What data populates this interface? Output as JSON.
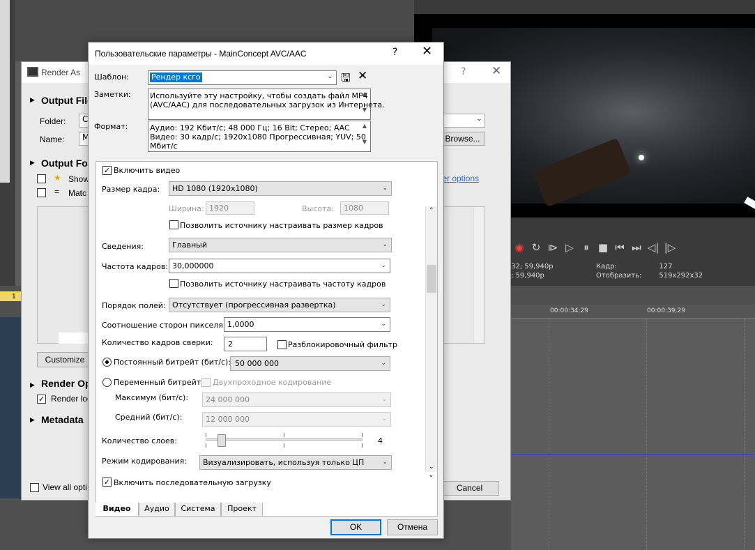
{
  "background": {
    "transport_icons": [
      "record-icon",
      "loop-icon",
      "play-from-start-icon",
      "play-icon",
      "pause-icon",
      "stop-icon",
      "prev-frame-icon",
      "next-frame-icon",
      "prev-marker-icon",
      "next-marker-icon"
    ],
    "info_left": [
      "32; 59,940p",
      "; 59,940p"
    ],
    "info_right_labels": [
      "Кадр:",
      "Отобразить:"
    ],
    "info_right_values": [
      "127",
      "519x292x32"
    ],
    "ruler_times": [
      "00:00:34;29",
      "00:00:39;29"
    ],
    "left_ruler_num": "1"
  },
  "render_as": {
    "title": "Render As",
    "sections": {
      "output_file": "Output File",
      "output_format": "Output Fo",
      "render_options": "Render Op",
      "metadata": "Metadata"
    },
    "folder_label": "Folder:",
    "folder_value": "C",
    "name_label": "Name:",
    "name_value": "M",
    "browse_label": "Browse...",
    "show_label": "Show",
    "match_label": "Matc",
    "customize_label": "Customize",
    "render_loop_label": "Render loc",
    "view_all_label": "View all opti",
    "cancel_label": "Cancel",
    "filter_link": "ter options"
  },
  "dialog": {
    "title": "Пользовательские параметры - MainConcept AVC/AAC",
    "help": "?",
    "template_label": "Шаблон:",
    "template_value": "Рендер ксго",
    "notes_label": "Заметки:",
    "notes_text": [
      "Используйте эту настройку, чтобы создать файл MP4",
      "(AVC/AAC) для последовательных загрузок из Интернета."
    ],
    "format_label": "Формат:",
    "format_text": [
      "Аудио: 192 Кбит/с; 48 000 Гц; 16 Bit; Стерео; AAC",
      "Видео: 30 кадр/с; 1920x1080 Прогрессивная; YUV; 50",
      "Мбит/с"
    ],
    "enable_video_label": "Включить видео",
    "frame_size_label": "Размер кадра:",
    "frame_size_value": "HD 1080 (1920x1080)",
    "width_label": "Ширина:",
    "width_value": "1920",
    "height_label": "Высота:",
    "height_value": "1080",
    "allow_frame_size_label": "Позволить источнику настраивать размер кадров",
    "profile_label": "Сведения:",
    "profile_value": "Главный",
    "frame_rate_label": "Частота кадров:",
    "frame_rate_value": "30,000000",
    "allow_frame_rate_label": "Позволить источнику настраивать частоту кадров",
    "field_order_label": "Порядок полей:",
    "field_order_value": "Отсутствует (прогрессивная развертка)",
    "pixel_aspect_label": "Соотношение сторон пикселя:",
    "pixel_aspect_value": "1,0000",
    "ref_frames_label": "Количество кадров сверки:",
    "ref_frames_value": "2",
    "deblock_label": "Разблокировочный фильтр",
    "cbr_label": "Постоянный битрейт (бит/с):",
    "cbr_value": "50 000 000",
    "vbr_label": "Переменный битрейт",
    "two_pass_label": "Двухпроходное кодирование",
    "max_label": "Максимум (бит/с):",
    "max_value": "24 000 000",
    "avg_label": "Средний (бит/с):",
    "avg_value": "12 000 000",
    "slices_label": "Количество слоев:",
    "slices_value": "4",
    "slices_level": 0.1,
    "encode_mode_label": "Режим кодирования:",
    "encode_mode_value": "Визуализировать, используя только ЦП",
    "progressive_download_label": "Включить последовательную загрузку",
    "tabs": [
      "Видео",
      "Аудио",
      "Система",
      "Проект"
    ],
    "ok_label": "OK",
    "cancel_label": "Отмена"
  }
}
